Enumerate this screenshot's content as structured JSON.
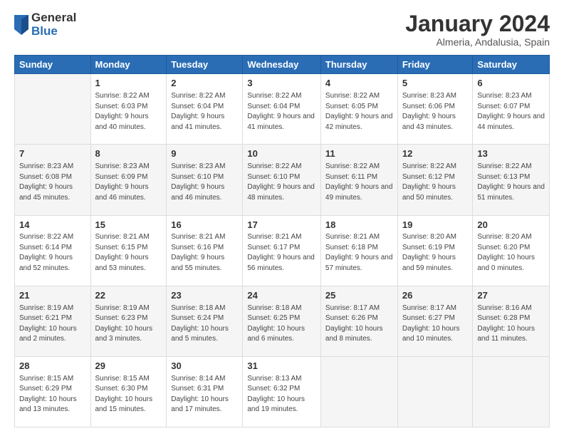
{
  "logo": {
    "general": "General",
    "blue": "Blue"
  },
  "header": {
    "month": "January 2024",
    "location": "Almeria, Andalusia, Spain"
  },
  "weekdays": [
    "Sunday",
    "Monday",
    "Tuesday",
    "Wednesday",
    "Thursday",
    "Friday",
    "Saturday"
  ],
  "weeks": [
    [
      {
        "day": "",
        "sunrise": "",
        "sunset": "",
        "daylight": ""
      },
      {
        "day": "1",
        "sunrise": "Sunrise: 8:22 AM",
        "sunset": "Sunset: 6:03 PM",
        "daylight": "Daylight: 9 hours and 40 minutes."
      },
      {
        "day": "2",
        "sunrise": "Sunrise: 8:22 AM",
        "sunset": "Sunset: 6:04 PM",
        "daylight": "Daylight: 9 hours and 41 minutes."
      },
      {
        "day": "3",
        "sunrise": "Sunrise: 8:22 AM",
        "sunset": "Sunset: 6:04 PM",
        "daylight": "Daylight: 9 hours and 41 minutes."
      },
      {
        "day": "4",
        "sunrise": "Sunrise: 8:22 AM",
        "sunset": "Sunset: 6:05 PM",
        "daylight": "Daylight: 9 hours and 42 minutes."
      },
      {
        "day": "5",
        "sunrise": "Sunrise: 8:23 AM",
        "sunset": "Sunset: 6:06 PM",
        "daylight": "Daylight: 9 hours and 43 minutes."
      },
      {
        "day": "6",
        "sunrise": "Sunrise: 8:23 AM",
        "sunset": "Sunset: 6:07 PM",
        "daylight": "Daylight: 9 hours and 44 minutes."
      }
    ],
    [
      {
        "day": "7",
        "sunrise": "Sunrise: 8:23 AM",
        "sunset": "Sunset: 6:08 PM",
        "daylight": "Daylight: 9 hours and 45 minutes."
      },
      {
        "day": "8",
        "sunrise": "Sunrise: 8:23 AM",
        "sunset": "Sunset: 6:09 PM",
        "daylight": "Daylight: 9 hours and 46 minutes."
      },
      {
        "day": "9",
        "sunrise": "Sunrise: 8:23 AM",
        "sunset": "Sunset: 6:10 PM",
        "daylight": "Daylight: 9 hours and 46 minutes."
      },
      {
        "day": "10",
        "sunrise": "Sunrise: 8:22 AM",
        "sunset": "Sunset: 6:10 PM",
        "daylight": "Daylight: 9 hours and 48 minutes."
      },
      {
        "day": "11",
        "sunrise": "Sunrise: 8:22 AM",
        "sunset": "Sunset: 6:11 PM",
        "daylight": "Daylight: 9 hours and 49 minutes."
      },
      {
        "day": "12",
        "sunrise": "Sunrise: 8:22 AM",
        "sunset": "Sunset: 6:12 PM",
        "daylight": "Daylight: 9 hours and 50 minutes."
      },
      {
        "day": "13",
        "sunrise": "Sunrise: 8:22 AM",
        "sunset": "Sunset: 6:13 PM",
        "daylight": "Daylight: 9 hours and 51 minutes."
      }
    ],
    [
      {
        "day": "14",
        "sunrise": "Sunrise: 8:22 AM",
        "sunset": "Sunset: 6:14 PM",
        "daylight": "Daylight: 9 hours and 52 minutes."
      },
      {
        "day": "15",
        "sunrise": "Sunrise: 8:21 AM",
        "sunset": "Sunset: 6:15 PM",
        "daylight": "Daylight: 9 hours and 53 minutes."
      },
      {
        "day": "16",
        "sunrise": "Sunrise: 8:21 AM",
        "sunset": "Sunset: 6:16 PM",
        "daylight": "Daylight: 9 hours and 55 minutes."
      },
      {
        "day": "17",
        "sunrise": "Sunrise: 8:21 AM",
        "sunset": "Sunset: 6:17 PM",
        "daylight": "Daylight: 9 hours and 56 minutes."
      },
      {
        "day": "18",
        "sunrise": "Sunrise: 8:21 AM",
        "sunset": "Sunset: 6:18 PM",
        "daylight": "Daylight: 9 hours and 57 minutes."
      },
      {
        "day": "19",
        "sunrise": "Sunrise: 8:20 AM",
        "sunset": "Sunset: 6:19 PM",
        "daylight": "Daylight: 9 hours and 59 minutes."
      },
      {
        "day": "20",
        "sunrise": "Sunrise: 8:20 AM",
        "sunset": "Sunset: 6:20 PM",
        "daylight": "Daylight: 10 hours and 0 minutes."
      }
    ],
    [
      {
        "day": "21",
        "sunrise": "Sunrise: 8:19 AM",
        "sunset": "Sunset: 6:21 PM",
        "daylight": "Daylight: 10 hours and 2 minutes."
      },
      {
        "day": "22",
        "sunrise": "Sunrise: 8:19 AM",
        "sunset": "Sunset: 6:23 PM",
        "daylight": "Daylight: 10 hours and 3 minutes."
      },
      {
        "day": "23",
        "sunrise": "Sunrise: 8:18 AM",
        "sunset": "Sunset: 6:24 PM",
        "daylight": "Daylight: 10 hours and 5 minutes."
      },
      {
        "day": "24",
        "sunrise": "Sunrise: 8:18 AM",
        "sunset": "Sunset: 6:25 PM",
        "daylight": "Daylight: 10 hours and 6 minutes."
      },
      {
        "day": "25",
        "sunrise": "Sunrise: 8:17 AM",
        "sunset": "Sunset: 6:26 PM",
        "daylight": "Daylight: 10 hours and 8 minutes."
      },
      {
        "day": "26",
        "sunrise": "Sunrise: 8:17 AM",
        "sunset": "Sunset: 6:27 PM",
        "daylight": "Daylight: 10 hours and 10 minutes."
      },
      {
        "day": "27",
        "sunrise": "Sunrise: 8:16 AM",
        "sunset": "Sunset: 6:28 PM",
        "daylight": "Daylight: 10 hours and 11 minutes."
      }
    ],
    [
      {
        "day": "28",
        "sunrise": "Sunrise: 8:15 AM",
        "sunset": "Sunset: 6:29 PM",
        "daylight": "Daylight: 10 hours and 13 minutes."
      },
      {
        "day": "29",
        "sunrise": "Sunrise: 8:15 AM",
        "sunset": "Sunset: 6:30 PM",
        "daylight": "Daylight: 10 hours and 15 minutes."
      },
      {
        "day": "30",
        "sunrise": "Sunrise: 8:14 AM",
        "sunset": "Sunset: 6:31 PM",
        "daylight": "Daylight: 10 hours and 17 minutes."
      },
      {
        "day": "31",
        "sunrise": "Sunrise: 8:13 AM",
        "sunset": "Sunset: 6:32 PM",
        "daylight": "Daylight: 10 hours and 19 minutes."
      },
      {
        "day": "",
        "sunrise": "",
        "sunset": "",
        "daylight": ""
      },
      {
        "day": "",
        "sunrise": "",
        "sunset": "",
        "daylight": ""
      },
      {
        "day": "",
        "sunrise": "",
        "sunset": "",
        "daylight": ""
      }
    ]
  ]
}
